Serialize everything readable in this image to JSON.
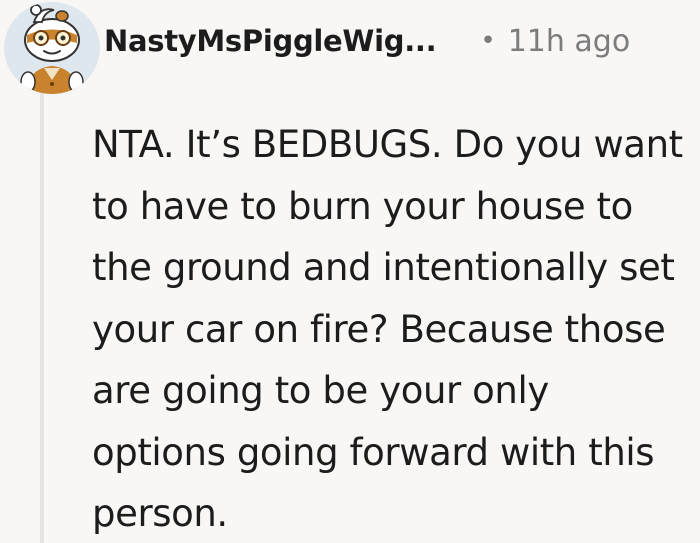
{
  "comment": {
    "username": "NastyMsPiggleWig...",
    "separator": "•",
    "timestamp": "11h ago",
    "body": "NTA. It’s BEDBUGS. Do you want to have to burn your house to the ground and intentionally set your car on fire? Because those are going to be your only options going forward with this person.",
    "avatar": {
      "icon": "snoo-avatar-icon",
      "background": "#dfe7ee",
      "accent": "#c9822d"
    }
  },
  "colors": {
    "background": "#f8f7f5",
    "text": "#1c1c1c",
    "meta": "#7c7c7c",
    "thread_line": "#e6e4e0"
  }
}
